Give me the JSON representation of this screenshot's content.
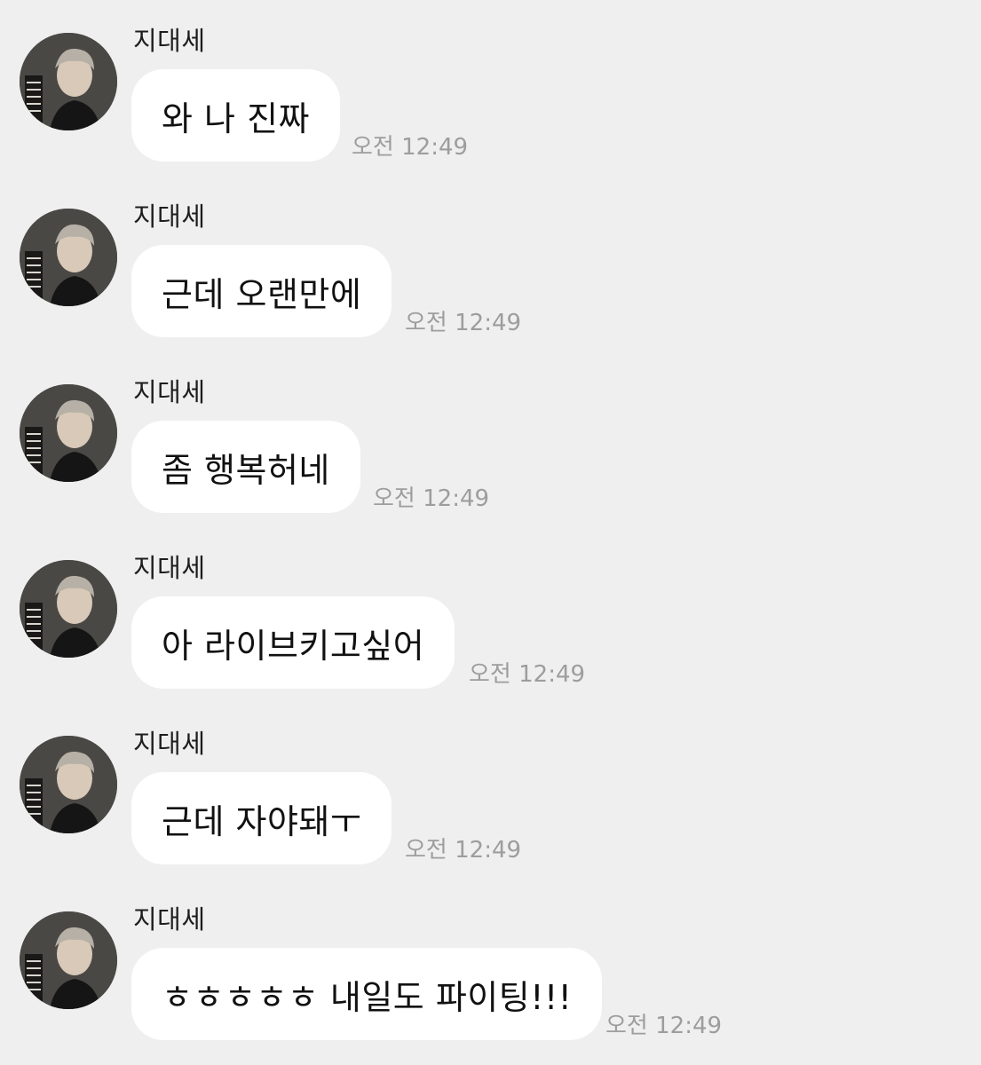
{
  "messages": [
    {
      "sender": "지대세",
      "text": "와 나 진짜",
      "time": "오전 12:49"
    },
    {
      "sender": "지대세",
      "text": "근데 오랜만에",
      "time": "오전 12:49"
    },
    {
      "sender": "지대세",
      "text": "좀 행복허네",
      "time": "오전 12:49"
    },
    {
      "sender": "지대세",
      "text": "아 라이브키고싶어",
      "time": "오전 12:49"
    },
    {
      "sender": "지대세",
      "text": "근데 자야돼ㅜ",
      "time": "오전 12:49"
    },
    {
      "sender": "지대세",
      "text": "ㅎㅎㅎㅎㅎ 내일도 파이팅!!!",
      "time": "오전 12:49"
    }
  ]
}
